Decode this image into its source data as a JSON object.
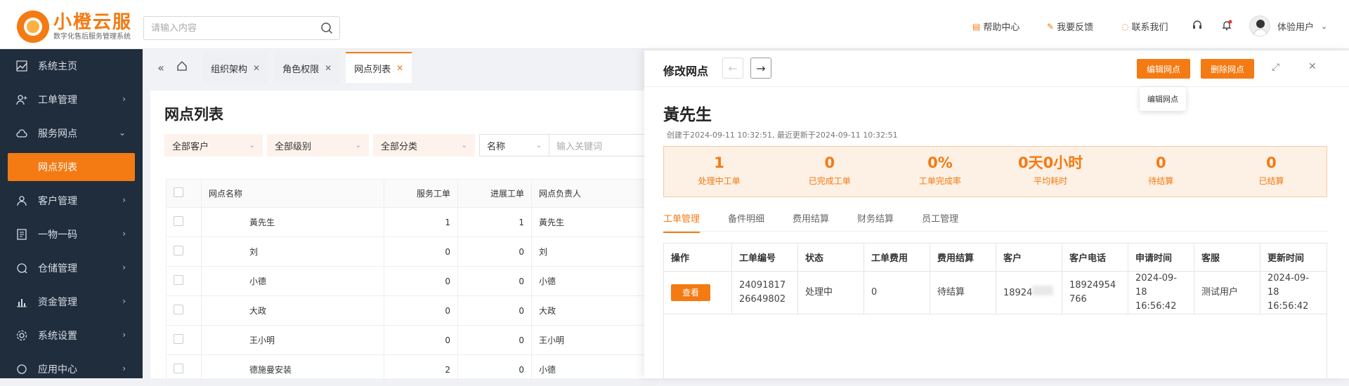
{
  "brand": {
    "title": "小橙云服",
    "subtitle": "数字化售后服务管理系统"
  },
  "search": {
    "placeholder": "请输入内容"
  },
  "topnav": {
    "help": "帮助中心",
    "feedback": "我要反馈",
    "contact": "联系我们",
    "user": "体验用户"
  },
  "sidebar": {
    "items": [
      {
        "label": "系统主页",
        "icon": "chart-icon"
      },
      {
        "label": "工单管理",
        "icon": "user-plus-icon"
      },
      {
        "label": "服务网点",
        "icon": "cloud-icon"
      },
      {
        "label": "网点列表",
        "icon": ""
      },
      {
        "label": "客户管理",
        "icon": "user-icon"
      },
      {
        "label": "一物一码",
        "icon": "document-icon"
      },
      {
        "label": "仓储管理",
        "icon": "chat-icon"
      },
      {
        "label": "资金管理",
        "icon": "bar-chart-icon"
      },
      {
        "label": "系统设置",
        "icon": "gear-icon"
      },
      {
        "label": "应用中心",
        "icon": "apps-icon"
      }
    ]
  },
  "tabs": [
    {
      "label": "组织架构"
    },
    {
      "label": "角色权限"
    },
    {
      "label": "网点列表"
    }
  ],
  "main": {
    "title": "网点列表",
    "filters": {
      "customer": "全部客户",
      "level": "全部级别",
      "category": "全部分类",
      "field": "名称",
      "keyword_placeholder": "输入关键词"
    },
    "columns": [
      "网点名称",
      "服务工单",
      "进展工单",
      "网点负责人"
    ],
    "rows": [
      {
        "name": "黃先生",
        "service": "1",
        "progress": "1",
        "owner": "黃先生"
      },
      {
        "name": "刘",
        "service": "0",
        "progress": "0",
        "owner": "刘"
      },
      {
        "name": "小德",
        "service": "0",
        "progress": "0",
        "owner": "小德"
      },
      {
        "name": "大政",
        "service": "0",
        "progress": "0",
        "owner": "大政"
      },
      {
        "name": "王小明",
        "service": "0",
        "progress": "0",
        "owner": "王小明"
      },
      {
        "name": "德施曼安装",
        "service": "2",
        "progress": "0",
        "owner": "小德"
      }
    ]
  },
  "panel": {
    "title": "修改网点",
    "edit_btn": "编辑网点",
    "delete_btn": "删除网点",
    "tooltip": "编辑网点",
    "name": "黃先生",
    "meta": "创建于2024-09-11 10:32:51, 最近更新于2024-09-11 10:32:51",
    "stats": [
      {
        "value": "1",
        "label": "处理中工单"
      },
      {
        "value": "0",
        "label": "已完成工单"
      },
      {
        "value": "0%",
        "label": "工单完成率"
      },
      {
        "value": "0天0小时",
        "label": "平均耗时"
      },
      {
        "value": "0",
        "label": "待结算"
      },
      {
        "value": "0",
        "label": "已结算"
      }
    ],
    "tabs": [
      "工单管理",
      "备件明细",
      "费用结算",
      "财务结算",
      "员工管理"
    ],
    "columns": [
      "操作",
      "工单编号",
      "状态",
      "工单费用",
      "费用结算",
      "客户",
      "客户电话",
      "申请时间",
      "客服",
      "更新时间"
    ],
    "row": {
      "action": "查看",
      "order_no": "2409181726649802",
      "status": "处理中",
      "fee": "0",
      "settle": "待结算",
      "customer": "18924",
      "phone": "18924954766",
      "apply_time": "2024-09-18 16:56:42",
      "service": "测试用户",
      "update_time": "2024-09-18 16:56:42"
    }
  }
}
